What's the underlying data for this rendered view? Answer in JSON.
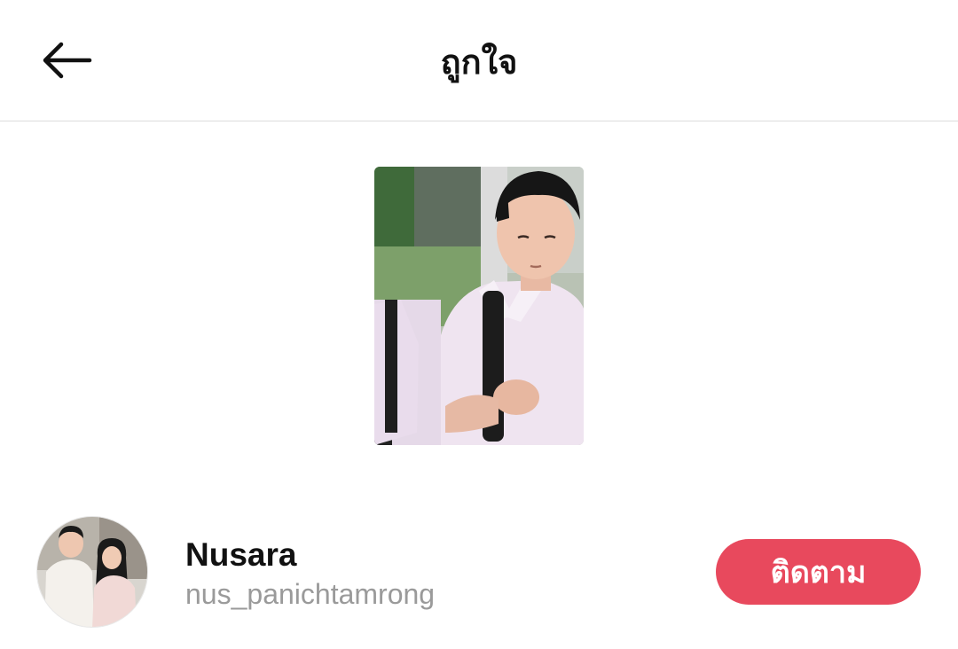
{
  "header": {
    "title": "ถูกใจ",
    "back_icon": "arrow-left-icon"
  },
  "liked_video": {
    "thumbnail": "video-thumbnail"
  },
  "user": {
    "display_name": "Nusara",
    "username": "nus_panichtamrong",
    "follow_label": "ติดตาม"
  },
  "colors": {
    "accent": "#e8495d",
    "text_primary": "#111111",
    "text_secondary": "#9a9a9a",
    "divider": "#dcdcdc"
  }
}
